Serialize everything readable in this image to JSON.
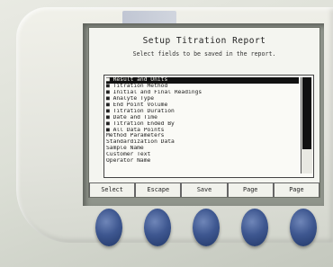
{
  "screen": {
    "title": "Setup Titration Report",
    "instruction": "Select fields to be saved in the report.",
    "fields": [
      {
        "label": "■ Result and Units",
        "selected": true
      },
      {
        "label": "■ Titration Method",
        "selected": false
      },
      {
        "label": "■ Initial and Final Readings",
        "selected": false
      },
      {
        "label": "■ Analyte Type",
        "selected": false
      },
      {
        "label": "■ End Point Volume",
        "selected": false
      },
      {
        "label": "■ Titration Duration",
        "selected": false
      },
      {
        "label": "■ Date and Time",
        "selected": false
      },
      {
        "label": "■ Titration Ended By",
        "selected": false
      },
      {
        "label": "■ All Data Points",
        "selected": false
      },
      {
        "label": "  Method Parameters",
        "selected": false
      },
      {
        "label": "  Standardization Data",
        "selected": false
      },
      {
        "label": "  Sample Name",
        "selected": false
      },
      {
        "label": "  Customer Text",
        "selected": false
      },
      {
        "label": "  Operator Name",
        "selected": false
      }
    ]
  },
  "softkeys": [
    "Select",
    "Escape",
    "Save",
    "Page",
    "Page"
  ]
}
